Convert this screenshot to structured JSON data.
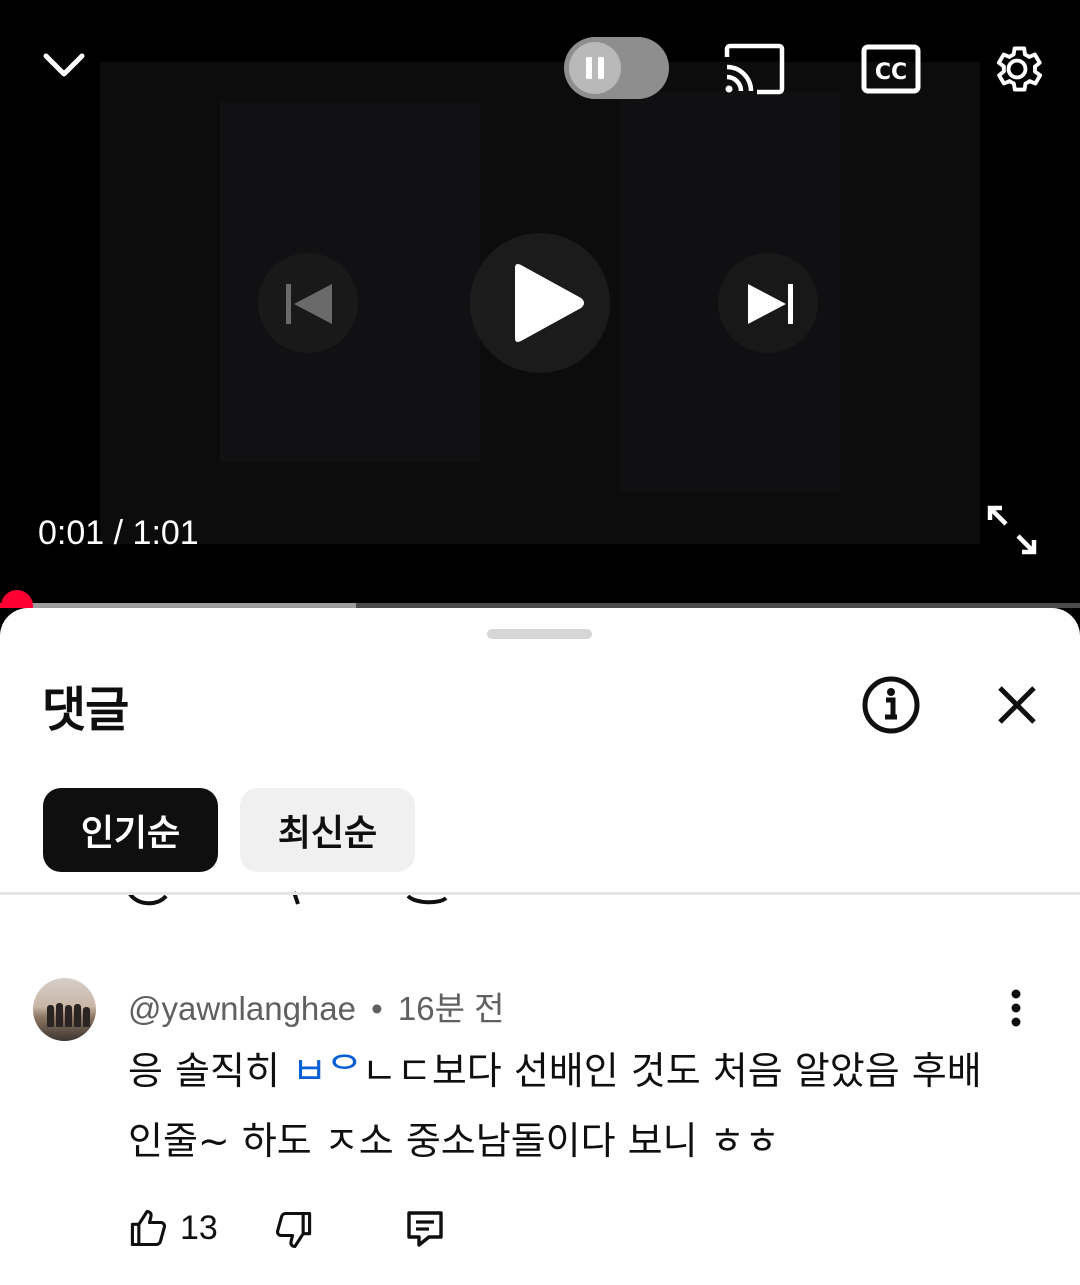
{
  "player": {
    "time_current": "0:01",
    "time_total": "1:01",
    "time_separator": "/",
    "progress_fraction": 0.016,
    "buffer_fraction": 0.33,
    "accent_color": "#ff0033",
    "icons": [
      "chevron-down-icon",
      "pause-icon",
      "cast-icon",
      "cc-icon",
      "gear-icon",
      "previous-icon",
      "play-icon",
      "next-icon",
      "fullscreen-icon"
    ]
  },
  "comments": {
    "title": "댓글",
    "sort_chips": [
      {
        "label": "인기순",
        "selected": true
      },
      {
        "label": "최신순",
        "selected": false
      }
    ],
    "items": [
      {
        "author": "@yawnlanghae",
        "separator": "•",
        "time": "16분 전",
        "text_before": "응 솔직히 ",
        "text_highlight": "ㅂᄋ",
        "text_after": "ㄴㄷ보다 선배인 것도 처음 알았음 후배인줄~ 하도 ㅈ소 중소남돌이다 보니 ㅎㅎ",
        "likes": "13"
      }
    ],
    "link_color": "#065fd4"
  }
}
